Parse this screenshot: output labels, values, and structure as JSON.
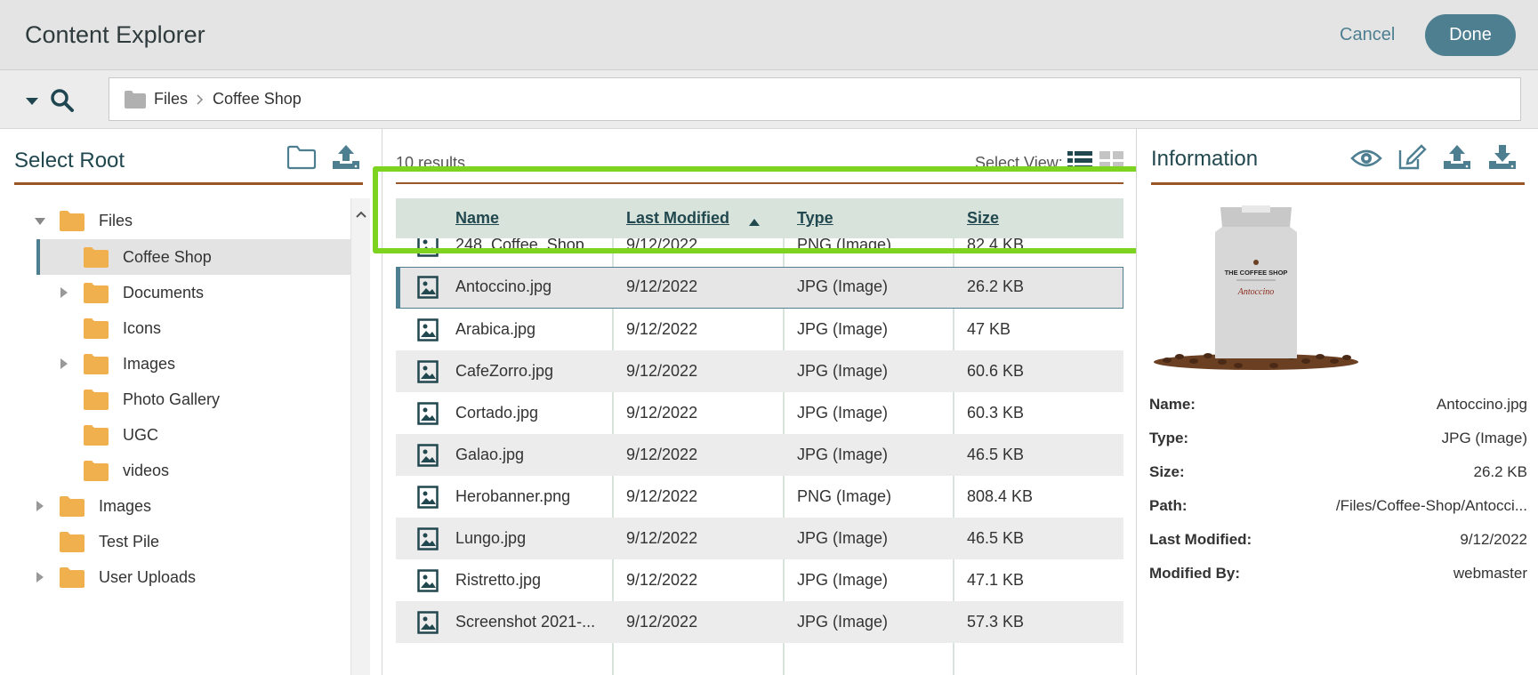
{
  "header": {
    "title": "Content Explorer",
    "cancel_label": "Cancel",
    "done_label": "Done"
  },
  "breadcrumb": {
    "items": [
      "Files",
      "Coffee Shop"
    ]
  },
  "left_panel": {
    "title": "Select Root",
    "tree": [
      {
        "label": "Files",
        "expanded": true,
        "has_children": true
      },
      {
        "label": "Coffee Shop",
        "selected": true
      },
      {
        "label": "Documents",
        "has_children": true
      },
      {
        "label": "Icons"
      },
      {
        "label": "Images",
        "has_children": true
      },
      {
        "label": "Photo Gallery"
      },
      {
        "label": "UGC"
      },
      {
        "label": "videos"
      },
      {
        "label": "Images",
        "has_children": true
      },
      {
        "label": "Test Pile"
      },
      {
        "label": "User Uploads",
        "has_children": true
      }
    ]
  },
  "results": {
    "count_label": "10 results",
    "select_view_label": "Select View:",
    "columns": [
      "Name",
      "Last Modified",
      "Type",
      "Size"
    ],
    "sort": {
      "column": "Last Modified",
      "direction": "ascending"
    },
    "rows": [
      {
        "name": "248_Coffee_Shop_...",
        "modified": "9/12/2022",
        "type": "PNG (Image)",
        "size": "82.4 KB"
      },
      {
        "name": "Antoccino.jpg",
        "modified": "9/12/2022",
        "type": "JPG (Image)",
        "size": "26.2 KB",
        "selected": true
      },
      {
        "name": "Arabica.jpg",
        "modified": "9/12/2022",
        "type": "JPG (Image)",
        "size": "47 KB"
      },
      {
        "name": "CafeZorro.jpg",
        "modified": "9/12/2022",
        "type": "JPG (Image)",
        "size": "60.6 KB"
      },
      {
        "name": "Cortado.jpg",
        "modified": "9/12/2022",
        "type": "JPG (Image)",
        "size": "60.3 KB"
      },
      {
        "name": "Galao.jpg",
        "modified": "9/12/2022",
        "type": "JPG (Image)",
        "size": "46.5 KB"
      },
      {
        "name": "Herobanner.png",
        "modified": "9/12/2022",
        "type": "PNG (Image)",
        "size": "808.4 KB"
      },
      {
        "name": "Lungo.jpg",
        "modified": "9/12/2022",
        "type": "JPG (Image)",
        "size": "46.5 KB"
      },
      {
        "name": "Ristretto.jpg",
        "modified": "9/12/2022",
        "type": "JPG (Image)",
        "size": "47.1 KB"
      },
      {
        "name": "Screenshot 2021-...",
        "modified": "9/12/2022",
        "type": "JPG (Image)",
        "size": "57.3 KB"
      }
    ]
  },
  "info": {
    "title": "Information",
    "preview": {
      "brand": "THE COFFEE SHOP",
      "product": "Antoccino"
    },
    "fields": [
      {
        "label": "Name:",
        "value": "Antoccino.jpg"
      },
      {
        "label": "Type:",
        "value": "JPG (Image)"
      },
      {
        "label": "Size:",
        "value": "26.2 KB"
      },
      {
        "label": "Path:",
        "value": "/Files/Coffee-Shop/Antocci..."
      },
      {
        "label": "Last Modified:",
        "value": "9/12/2022"
      },
      {
        "label": "Modified By:",
        "value": "webmaster"
      }
    ]
  },
  "colors": {
    "accent": "#4e7f91",
    "rule": "#9b5628",
    "folder": "#f0b04e",
    "highlight": "#7ed321",
    "header_row": "#d8e3db"
  }
}
